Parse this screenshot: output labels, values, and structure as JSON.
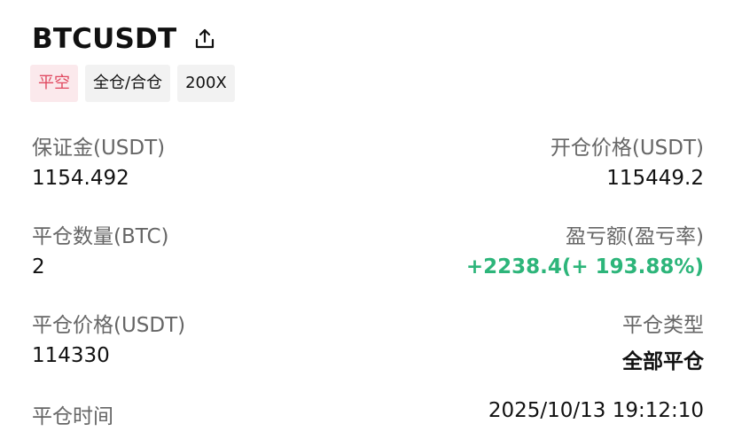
{
  "header": {
    "symbol": "BTCUSDT",
    "share_icon": "share-icon"
  },
  "tags": {
    "side": "平空",
    "margin_mode": "全仓/合仓",
    "leverage": "200X"
  },
  "fields": {
    "margin": {
      "label": "保证金(USDT)",
      "value": "1154.492"
    },
    "open_price": {
      "label": "开仓价格(USDT)",
      "value": "115449.2"
    },
    "close_qty": {
      "label": "平仓数量(BTC)",
      "value": "2"
    },
    "pnl": {
      "label": "盈亏额(盈亏率)",
      "value": "+2238.4(+ 193.88%)"
    },
    "close_price": {
      "label": "平仓价格(USDT)",
      "value": "114330"
    },
    "close_type": {
      "label": "平仓类型",
      "value": "全部平仓"
    },
    "close_time": {
      "label": "平仓时间",
      "value": "2025/10/13 19:12:10"
    }
  },
  "colors": {
    "side_tag_text": "#e0485f",
    "side_tag_bg": "#fbe9ec",
    "tag_bg": "#f2f2f2",
    "profit_green": "#2db57a",
    "label_gray": "#666666",
    "text_primary": "#111111"
  }
}
